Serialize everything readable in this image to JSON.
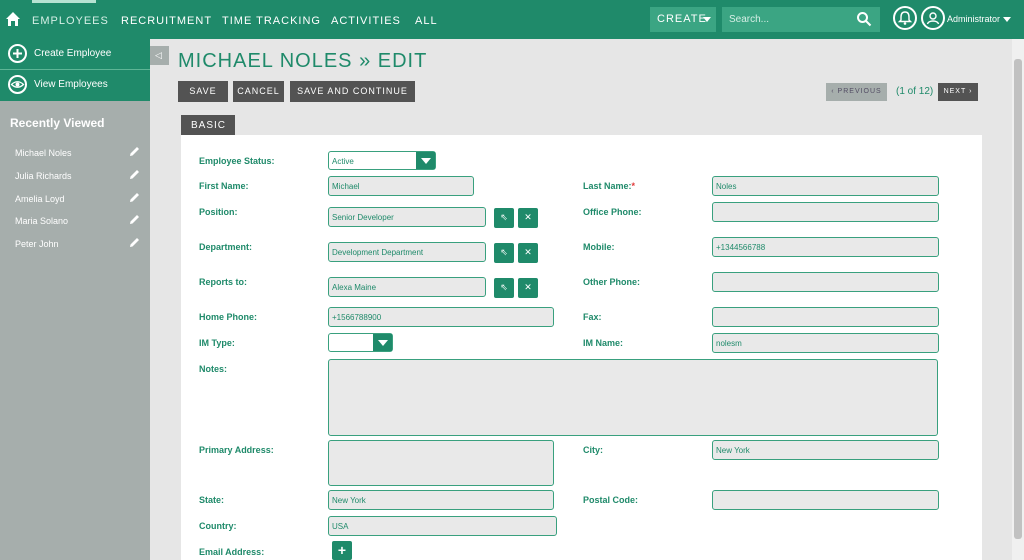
{
  "nav": {
    "items": [
      "EMPLOYEES",
      "RECRUITMENT",
      "TIME TRACKING",
      "ACTIVITIES",
      "ALL"
    ],
    "create_label": "CREATE",
    "search_placeholder": "Search...",
    "user_name": "Administrator"
  },
  "sidebar": {
    "actions": [
      "Create Employee",
      "View Employees"
    ],
    "recent_title": "Recently Viewed",
    "recent": [
      "Michael Noles",
      "Julia Richards",
      "Amelia Loyd",
      "Maria Solano",
      "Peter John"
    ]
  },
  "page": {
    "title": "MICHAEL NOLES » EDIT",
    "buttons": {
      "save": "SAVE",
      "cancel": "CANCEL",
      "save_continue": "SAVE AND CONTINUE"
    },
    "pager": {
      "previous": "PREVIOUS",
      "position": "(1 of 12)",
      "next": "NEXT"
    },
    "tab": "BASIC"
  },
  "form": {
    "employee_status": {
      "label": "Employee Status:",
      "value": "Active"
    },
    "first_name": {
      "label": "First Name:",
      "value": "Michael"
    },
    "last_name": {
      "label": "Last Name:",
      "required": "*",
      "value": "Noles"
    },
    "position": {
      "label": "Position:",
      "value": "Senior Developer"
    },
    "office_phone": {
      "label": "Office Phone:",
      "value": ""
    },
    "department": {
      "label": "Department:",
      "value": "Development Department"
    },
    "mobile": {
      "label": "Mobile:",
      "value": "+1344566788"
    },
    "reports_to": {
      "label": "Reports to:",
      "value": "Alexa Maine"
    },
    "other_phone": {
      "label": "Other Phone:",
      "value": ""
    },
    "home_phone": {
      "label": "Home Phone:",
      "value": "+1566788900"
    },
    "fax": {
      "label": "Fax:",
      "value": ""
    },
    "im_type": {
      "label": "IM Type:",
      "value": ""
    },
    "im_name": {
      "label": "IM Name:",
      "value": "nolesm"
    },
    "notes": {
      "label": "Notes:",
      "value": ""
    },
    "primary_address": {
      "label": "Primary Address:",
      "value": ""
    },
    "city": {
      "label": "City:",
      "value": "New York"
    },
    "state": {
      "label": "State:",
      "value": "New York"
    },
    "postal_code": {
      "label": "Postal Code:",
      "value": ""
    },
    "country": {
      "label": "Country:",
      "value": "USA"
    },
    "email": {
      "label": "Email Address:"
    }
  },
  "colors": {
    "primary": "#1f8a6a",
    "accent": "#3ba583",
    "sidebar": "#a6aeac",
    "button_dark": "#535353"
  }
}
